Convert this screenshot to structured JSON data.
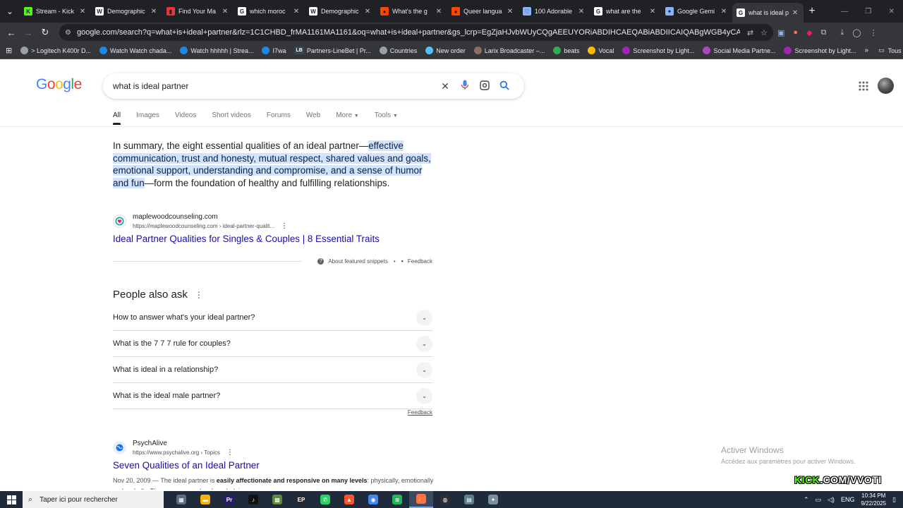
{
  "browser": {
    "tabs": [
      {
        "title": "Stream - Kick",
        "color": "#53fc18",
        "glyph": "K"
      },
      {
        "title": "Demographic",
        "color": "#ffffff",
        "glyph": "W"
      },
      {
        "title": "Find Your Ma",
        "color": "#e53935",
        "glyph": "▮"
      },
      {
        "title": "which moroc",
        "color": "#ffffff",
        "glyph": "G"
      },
      {
        "title": "Demographic",
        "color": "#ffffff",
        "glyph": "W"
      },
      {
        "title": "What's the g",
        "color": "#ff4500",
        "glyph": "●"
      },
      {
        "title": "Queer langua",
        "color": "#ff4500",
        "glyph": "●"
      },
      {
        "title": "100 Adorable",
        "color": "#8ab4f8",
        "glyph": "♡"
      },
      {
        "title": "what are the",
        "color": "#ffffff",
        "glyph": "G"
      },
      {
        "title": "Google Gemi",
        "color": "#8ab4f8",
        "glyph": "✦"
      },
      {
        "title": "what is ideal p",
        "color": "#ffffff",
        "glyph": "G"
      }
    ],
    "url": "google.com/search?q=what+is+ideal+partner&rlz=1C1CHBD_frMA1161MA1161&oq=what+is+ideal+partner&gs_lcrp=EgZjaHJvbWUyCQgAEEUYORiABDIHCAEQABiABDIICAIQABgWGB4yCAgDEAAYFhgeMggIBBAAG...",
    "bookmarks": [
      {
        "label": "> Logitech K400r D...",
        "color": "#9aa0a6"
      },
      {
        "label": "Watch Watch chada...",
        "color": "#1e88e5"
      },
      {
        "label": "Watch hhhhh | Strea...",
        "color": "#1e88e5"
      },
      {
        "label": "I7wa",
        "color": "#1e88e5"
      },
      {
        "label": "Partners-LineBet | Pr...",
        "color": "#37474f",
        "glyph": "LB"
      },
      {
        "label": "Countries",
        "color": "#9aa0a6"
      },
      {
        "label": "New order",
        "color": "#4fc3f7"
      },
      {
        "label": "Larix Broadcaster –...",
        "color": "#8d6e63"
      },
      {
        "label": "beats",
        "color": "#34a853"
      },
      {
        "label": "Vocal",
        "color": "#fbbc04"
      },
      {
        "label": "Screenshot by Light...",
        "color": "#9c27b0"
      },
      {
        "label": "Social Media Partne...",
        "color": "#ab47bc"
      },
      {
        "label": "Screenshot by Light...",
        "color": "#9c27b0"
      }
    ],
    "bookmarks_more": "»",
    "bookmarks_folder": "Tous les favoris"
  },
  "search": {
    "query": "what is ideal partner",
    "tabs": [
      "All",
      "Images",
      "Videos",
      "Short videos",
      "Forums",
      "Web",
      "More",
      "Tools"
    ]
  },
  "featured": {
    "text_before": "In summary, the eight essential qualities of an ideal partner—",
    "text_highlight": "effective communication, trust and honesty, mutual respect, shared values and goals, emotional support, understanding and compromise, and a sense of humor and fun",
    "text_after": "—form the foundation of healthy and fulfilling relationships.",
    "source_name": "maplewoodcounseling.com",
    "source_url": "https://maplewoodcounseling.com › ideal-partner-qualit...",
    "link_title": "Ideal Partner Qualities for Singles & Couples | 8 Essential Traits",
    "about_label": "About featured snippets",
    "feedback_label": "Feedback"
  },
  "paa": {
    "title": "People also ask",
    "questions": [
      "How to answer what's your ideal partner?",
      "What is the 7 7 7 rule for couples?",
      "What is ideal in a relationship?",
      "What is the ideal male partner?"
    ],
    "feedback_label": "Feedback"
  },
  "result2": {
    "source_name": "PsychAlive",
    "source_url": "https://www.psychalive.org › Topics",
    "title": "Seven Qualities of an Ideal Partner",
    "snippet_date": "Nov 20, 2009 — The ideal partner is ",
    "snippet_bold": "easily affectionate and responsive on many levels",
    "snippet_rest": ": physically, emotionally and verbally. They are personal, acknowledging..."
  },
  "overlay": {
    "activate_title": "Activer Windows",
    "activate_sub": "Accédez aux paramètres pour activer Windows.",
    "kick_green": "KICK",
    "kick_white": ".COM/VVOTI"
  },
  "taskbar": {
    "search_placeholder": "Taper ici pour rechercher",
    "apps": [
      {
        "name": "task-view",
        "color": "#5f6b7a",
        "glyph": "▦"
      },
      {
        "name": "file-explorer",
        "color": "#f4b400",
        "glyph": "▬"
      },
      {
        "name": "premiere",
        "color": "#2d1b69",
        "glyph": "Pr"
      },
      {
        "name": "tiktok",
        "color": "#111111",
        "glyph": "♪"
      },
      {
        "name": "minecraft",
        "color": "#5d8a3c",
        "glyph": "▩"
      },
      {
        "name": "epic-games",
        "color": "#2a2a2a",
        "glyph": "EP"
      },
      {
        "name": "whatsapp",
        "color": "#25d366",
        "glyph": "✆"
      },
      {
        "name": "brave",
        "color": "#fb542b",
        "glyph": "▲"
      },
      {
        "name": "chrome",
        "color": "#4285f4",
        "glyph": "◉"
      },
      {
        "name": "spotify",
        "color": "#1db954",
        "glyph": "≋"
      },
      {
        "name": "microphone",
        "color": "#ff7043",
        "glyph": "♩"
      },
      {
        "name": "obs",
        "color": "#302e31",
        "glyph": "◍"
      },
      {
        "name": "calculator",
        "color": "#607d8b",
        "glyph": "▤"
      },
      {
        "name": "other-app",
        "color": "#78909c",
        "glyph": "✦"
      }
    ],
    "lang": "ENG",
    "time": "10:34 PM",
    "date": "9/22/2025"
  }
}
